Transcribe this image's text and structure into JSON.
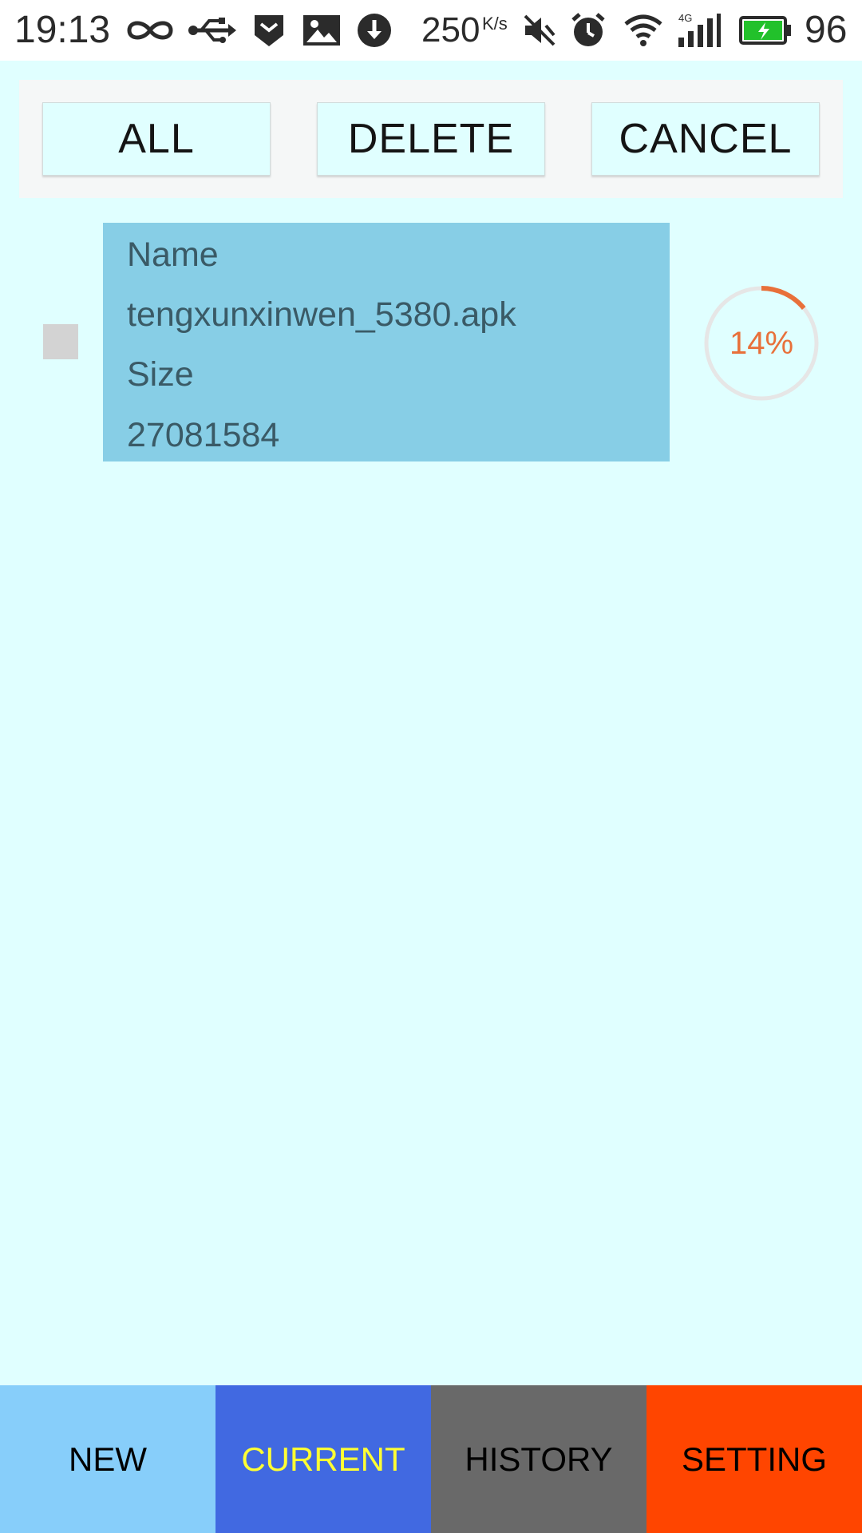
{
  "status_bar": {
    "time": "19:13",
    "speed": "250",
    "speed_unit": "K/s",
    "battery_level": "96",
    "icons": [
      "infinity-icon",
      "usb-icon",
      "shield-icon",
      "image-icon",
      "download-icon",
      "mute-icon",
      "alarm-icon",
      "wifi-icon",
      "signal-4g-icon",
      "battery-charging-icon"
    ]
  },
  "toolbar": {
    "all_label": "ALL",
    "delete_label": "DELETE",
    "cancel_label": "CANCEL"
  },
  "downloads": [
    {
      "name_label": "Name",
      "name": "tengxunxinwen_5380.apk",
      "size_label": "Size",
      "size": "27081584",
      "progress_text": "14%",
      "progress": 0.14,
      "checked": false
    }
  ],
  "tabs": [
    {
      "label": "NEW",
      "bg": "#87CEFA",
      "fg": "#000000"
    },
    {
      "label": "CURRENT",
      "bg": "#4169E1",
      "fg": "#FFFF33"
    },
    {
      "label": "HISTORY",
      "bg": "#696969",
      "fg": "#000000"
    },
    {
      "label": "SETTING",
      "bg": "#FF4500",
      "fg": "#000000"
    }
  ],
  "colors": {
    "background": "#E0FFFF",
    "card": "#87CEE6",
    "progress_arc": "#E8703A",
    "progress_track": "#E6E6E6"
  }
}
